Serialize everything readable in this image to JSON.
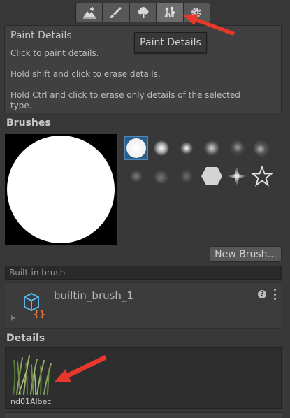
{
  "toolbar": {
    "buttons": [
      {
        "name": "raise-terrain-tool",
        "icon": "mountain-plus-icon"
      },
      {
        "name": "paint-texture-tool",
        "icon": "paintbrush-icon"
      },
      {
        "name": "paint-trees-tool",
        "icon": "tree-icon"
      },
      {
        "name": "paint-details-tool",
        "icon": "grass-flowers-icon",
        "active": true
      },
      {
        "name": "terrain-settings-tool",
        "icon": "gear-icon"
      }
    ]
  },
  "help": {
    "title": "Paint Details",
    "line1": "Click to paint details.",
    "line2": "Hold shift and click to erase details.",
    "line3": "Hold Ctrl and click to erase only details of the selected",
    "line4": "type."
  },
  "tooltip": {
    "text": "Paint Details"
  },
  "brushes": {
    "heading": "Brushes",
    "new_brush_label": "New Brush...",
    "builtin_label": "Built-in brush",
    "selected_brush_name": "builtin_brush_1"
  },
  "details": {
    "heading": "Details",
    "item_label": "nd01Albec"
  },
  "colors": {
    "panel": "#383838",
    "selection": "#2c5d87",
    "annotation_arrow": "#e8372b",
    "icon_blue": "#5ab6e6",
    "icon_orange": "#f07a3a"
  }
}
